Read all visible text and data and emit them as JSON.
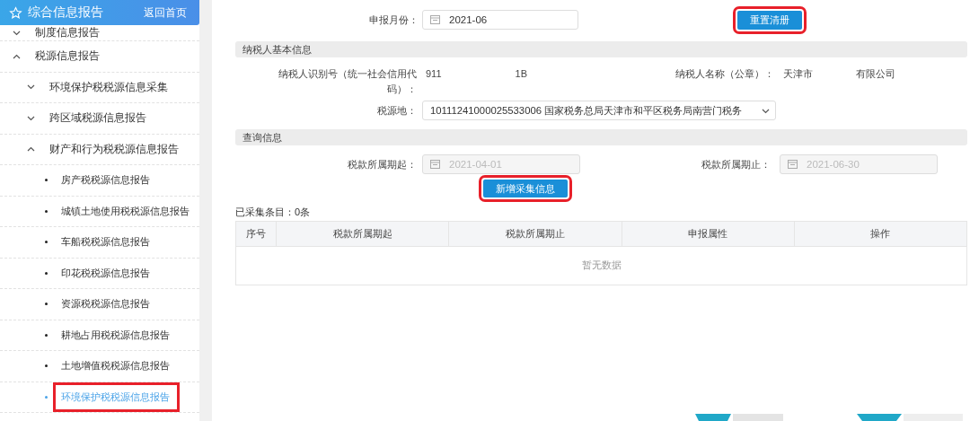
{
  "sidebar": {
    "title": "综合信息报告",
    "home_link": "返回首页",
    "items": [
      {
        "label": "制度信息报告",
        "expanded": false
      },
      {
        "label": "税源信息报告",
        "expanded": true,
        "children": [
          {
            "label": "环境保护税税源信息采集",
            "expanded": false
          },
          {
            "label": "跨区域税源信息报告",
            "expanded": false
          },
          {
            "label": "财产和行为税税源信息报告",
            "expanded": true,
            "children": [
              {
                "label": "房产税税源信息报告",
                "selected": false,
                "annotated": false
              },
              {
                "label": "城镇土地使用税税源信息报告",
                "selected": false,
                "annotated": false
              },
              {
                "label": "车船税税源信息报告",
                "selected": false,
                "annotated": false
              },
              {
                "label": "印花税税源信息报告",
                "selected": false,
                "annotated": false
              },
              {
                "label": "资源税税源信息报告",
                "selected": false,
                "annotated": false
              },
              {
                "label": "耕地占用税税源信息报告",
                "selected": false,
                "annotated": false
              },
              {
                "label": "土地增值税税源信息报告",
                "selected": false,
                "annotated": false
              },
              {
                "label": "环境保护税税源信息报告",
                "selected": true,
                "annotated": true
              }
            ]
          }
        ]
      }
    ]
  },
  "report_month": {
    "label": "申报月份：",
    "value": "2021-06"
  },
  "reset_button": {
    "label": "重置清册",
    "annotated": true
  },
  "taxpayer_info": {
    "title": "纳税人基本信息",
    "taxpayer_id": {
      "label": "纳税人识别号（统一社会信用代码）：",
      "value_parts": [
        "911",
        "1B"
      ]
    },
    "taxpayer_name": {
      "label": "纳税人名称（公章）：",
      "value_parts": [
        "天津市",
        "有限公司"
      ]
    },
    "tax_source_location": {
      "label": "税源地：",
      "value": "10111241000025533006 国家税务总局天津市和平区税务局南营门税务"
    }
  },
  "query_info": {
    "title": "查询信息",
    "period_start": {
      "label": "税款所属期起：",
      "value": "2021-04-01",
      "disabled": true
    },
    "period_end": {
      "label": "税款所属期止：",
      "value": "2021-06-30",
      "disabled": true
    }
  },
  "add_button": {
    "label": "新增采集信息",
    "annotated": true
  },
  "collected_count": "已采集条目：0条",
  "table": {
    "columns": [
      "序号",
      "税款所属期起",
      "税款所属期止",
      "申报属性",
      "操作"
    ],
    "empty_text": "暂无数据"
  }
}
